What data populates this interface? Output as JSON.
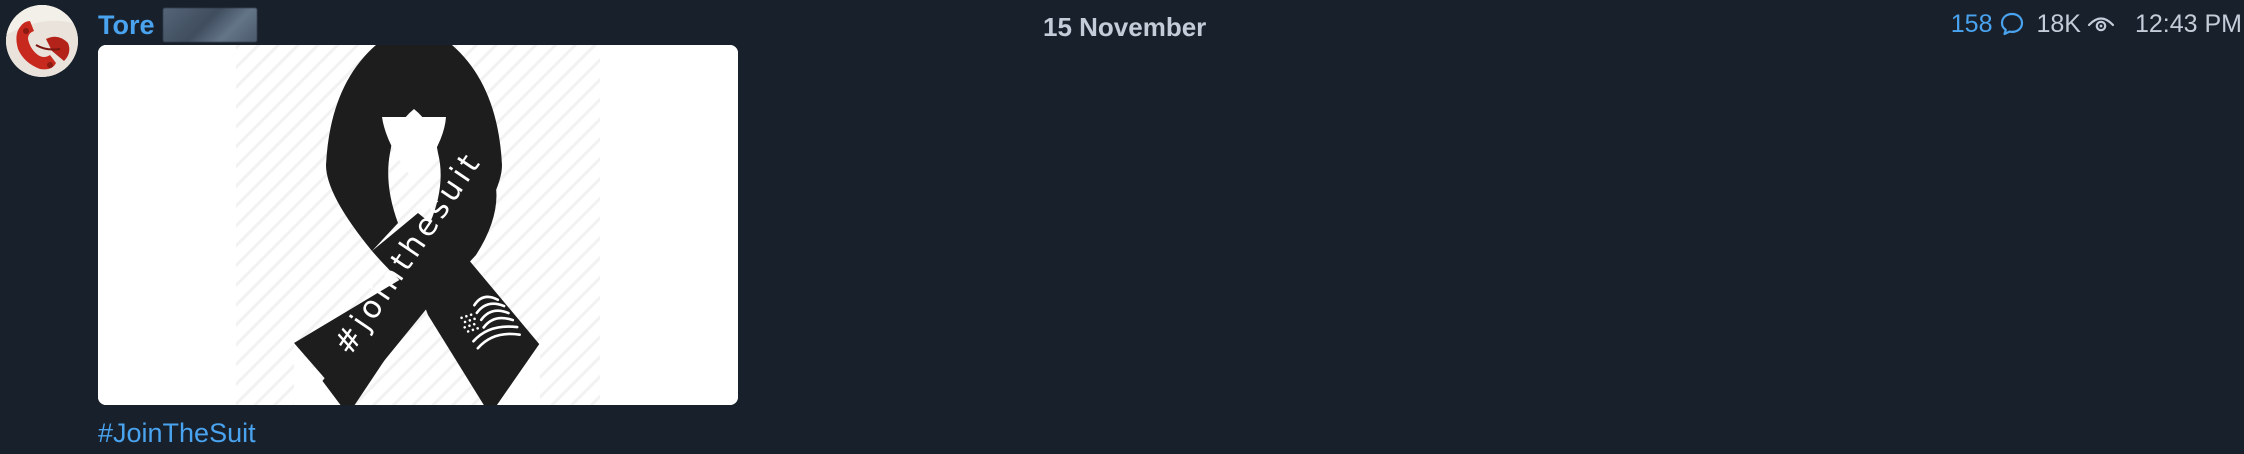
{
  "post": {
    "author_name": "Tore",
    "date_label": "15 November",
    "comments_count": "158",
    "views_count": "18K",
    "time": "12:43 PM",
    "hashtag": "#JoinTheSuit"
  },
  "media": {
    "ribbon_text": "#jointhesuit"
  },
  "icons": {
    "avatar": "red-telephone-avatar",
    "comments": "comment-bubble-icon",
    "views": "eye-icon",
    "flag": "us-flag-icon"
  },
  "colors": {
    "background": "#18202b",
    "accent": "#4aa3ef",
    "muted_text": "#c3ccd8",
    "ribbon": "#1d1d1d"
  }
}
